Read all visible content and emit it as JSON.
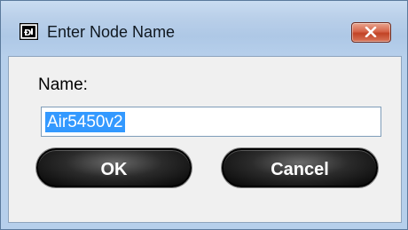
{
  "window": {
    "title": "Enter Node Name",
    "app_icon": "dialog-app-icon",
    "close_icon": "close-icon"
  },
  "form": {
    "name_label": "Name:",
    "name_value": "Air5450v2"
  },
  "buttons": {
    "ok_label": "OK",
    "cancel_label": "Cancel"
  },
  "colors": {
    "selection": "#3399ff",
    "close_button": "#c14325",
    "button_face": "#000000"
  }
}
